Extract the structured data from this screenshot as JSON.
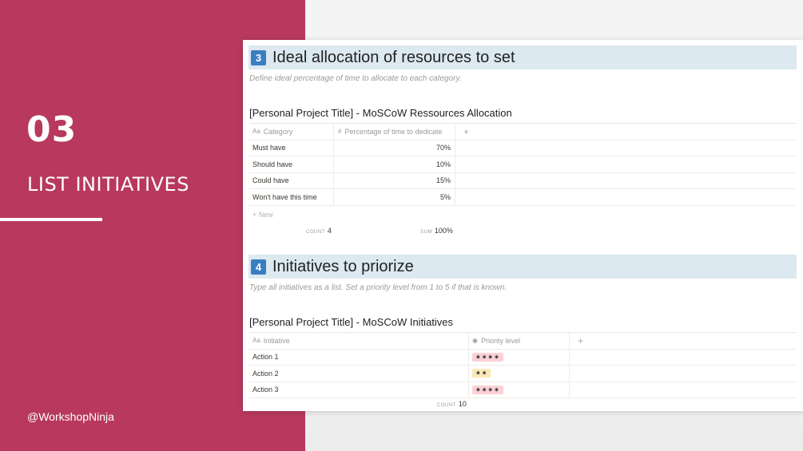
{
  "slide": {
    "number": "03",
    "title": "LIST INITIATIVES",
    "handle": "@WorkshopNinja",
    "accent_color": "#b8395d"
  },
  "section3": {
    "badge": "3",
    "heading": "Ideal allocation of resources to set",
    "hint": "Define ideal percentage of time to allocate to each category.",
    "table_title": "[Personal Project Title] - MoSCoW Ressources Allocation",
    "columns": [
      "Category",
      "Percentage of time to dedicate",
      "+"
    ],
    "rows": [
      {
        "category": "Must have",
        "percent": "70%"
      },
      {
        "category": "Should have",
        "percent": "10%"
      },
      {
        "category": "Could have",
        "percent": "15%"
      },
      {
        "category": "Won't have this time",
        "percent": "5%"
      }
    ],
    "new_label": "+ New",
    "count_label": "COUNT",
    "count_value": "4",
    "sum_label": "SUM",
    "sum_value": "100%"
  },
  "section4": {
    "badge": "4",
    "heading": "Initiatives to priorize",
    "hint": "Type all initiatives as a list. Set a priority level from 1 to 5 if that is known.",
    "table_title": "[Personal Project Title] - MoSCoW Initiatives",
    "columns": [
      "Initiative",
      "Priority level",
      "+"
    ],
    "rows": [
      {
        "initiative": "Action 1",
        "priority": "✷✷✷✷",
        "color": "pink"
      },
      {
        "initiative": "Action 2",
        "priority": "✷✷",
        "color": "yellow"
      },
      {
        "initiative": "Action 3",
        "priority": "✷✷✷✷",
        "color": "pink"
      }
    ],
    "count_label": "COUNT",
    "count_value": "10"
  }
}
